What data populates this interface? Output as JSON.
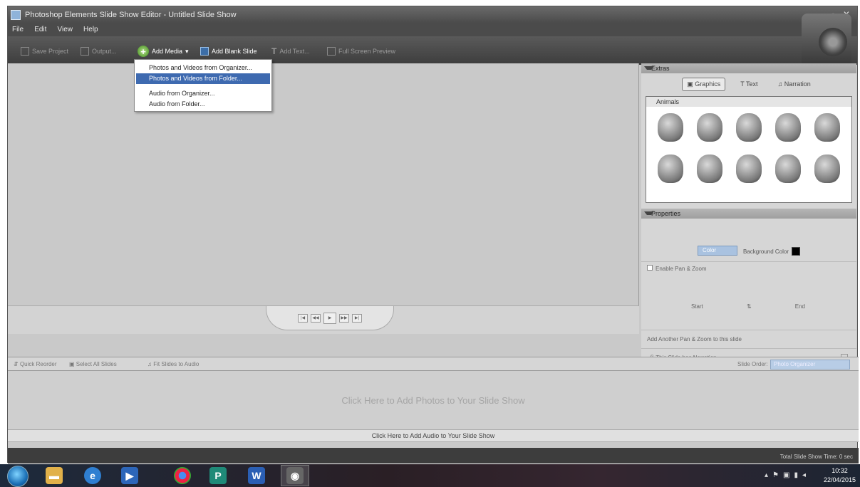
{
  "window": {
    "title": "Photoshop Elements Slide Show Editor - Untitled Slide Show"
  },
  "menu": [
    "File",
    "Edit",
    "View",
    "Help"
  ],
  "toolbar": {
    "save_project": "Save Project",
    "output": "Output...",
    "add_media": "Add Media",
    "add_blank_slide": "Add Blank Slide",
    "add_text": "Add Text...",
    "full_screen_preview": "Full Screen Preview"
  },
  "add_media_menu": [
    "Photos and Videos from Organizer...",
    "Photos and Videos from Folder...",
    "Audio from Organizer...",
    "Audio from Folder..."
  ],
  "extras": {
    "header": "Extras",
    "tabs": [
      "Graphics",
      "Text",
      "Narration"
    ],
    "category": "Animals"
  },
  "properties": {
    "header": "Properties",
    "style": "Color",
    "background_color_label": "Background Color",
    "background_color": "#000000",
    "enable_pan_zoom": "Enable Pan & Zoom",
    "start": "Start",
    "end": "End",
    "add_pan_zoom": "Add Another Pan & Zoom to this slide",
    "narration": "This Slide has Narration"
  },
  "sorter": {
    "quick_reorder": "Quick Reorder",
    "select_all": "Select All Slides",
    "fit_to_audio": "Fit Slides to Audio",
    "slide_order_label": "Slide Order:",
    "slide_order_value": "Photo Organizer"
  },
  "slide_area_prompt": "Click Here to Add Photos to Your Slide Show",
  "audio_prompt": "Click Here to Add Audio to Your Slide Show",
  "status": "Total Slide Show Time: 0 sec",
  "clock": {
    "time": "10:32",
    "date": "22/04/2015"
  }
}
